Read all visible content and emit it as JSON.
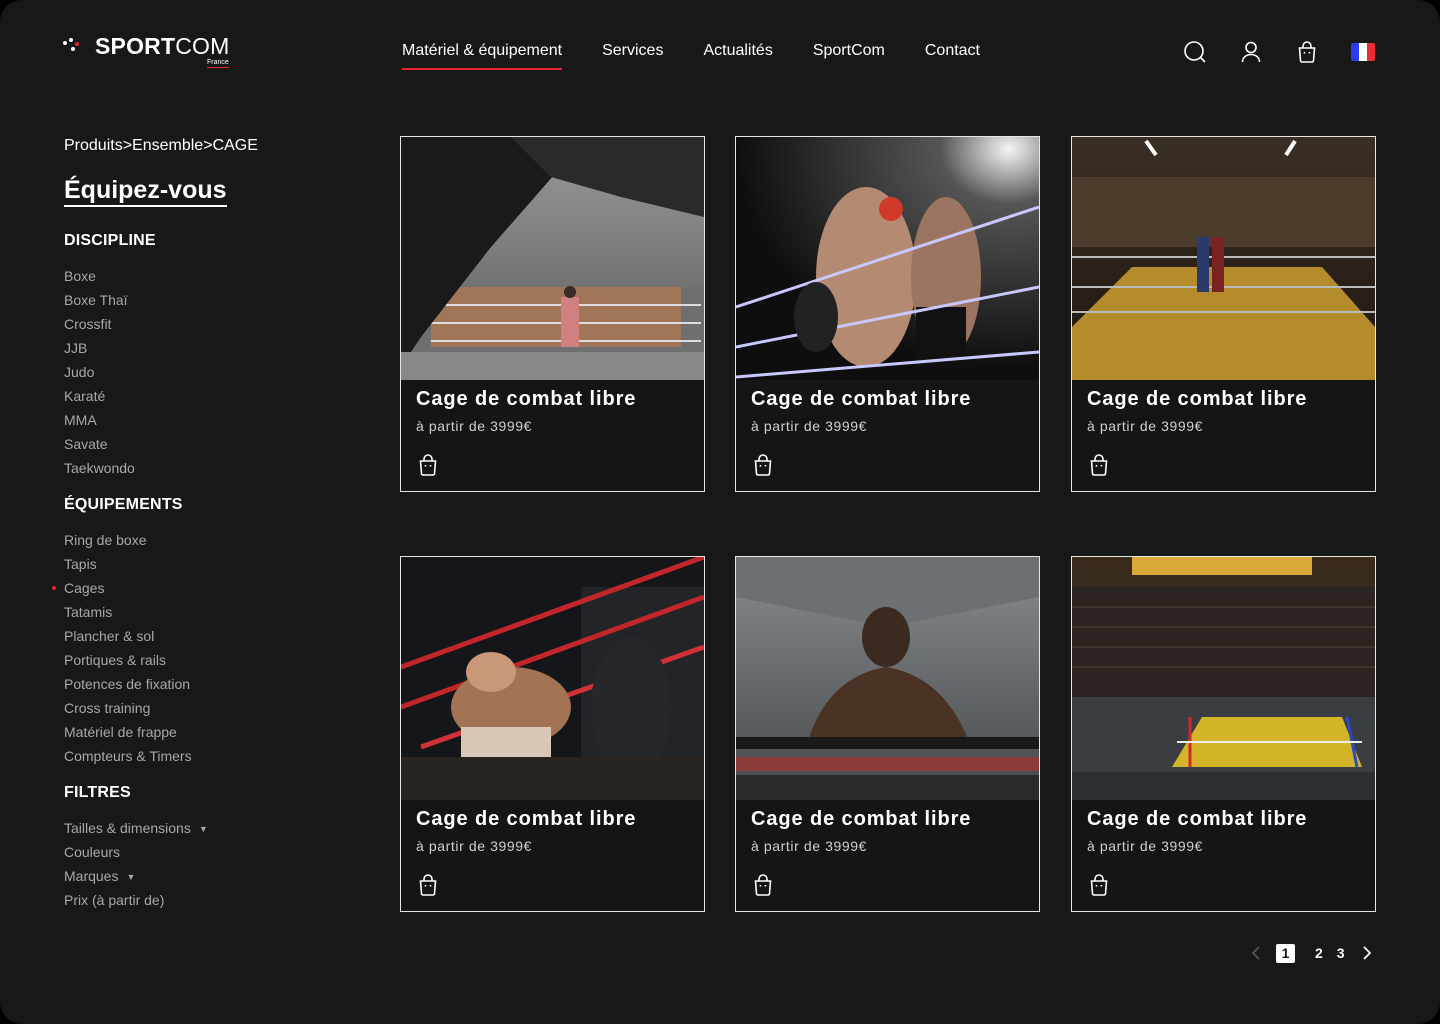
{
  "brand": {
    "name_bold": "SPORT",
    "name_light": "COM",
    "region": "France",
    "accent_color": "#e8232d"
  },
  "nav": {
    "items": [
      {
        "label": "Matériel & équipement",
        "active": true
      },
      {
        "label": "Services",
        "active": false
      },
      {
        "label": "Actualités",
        "active": false
      },
      {
        "label": "SportCom",
        "active": false
      },
      {
        "label": "Contact",
        "active": false
      }
    ]
  },
  "header_icons": [
    "search-icon",
    "user-icon",
    "bag-icon",
    "flag-fr-icon"
  ],
  "breadcrumb": "Produits>Ensemble>CAGE",
  "page_title": "Équipez-vous",
  "sidebar": {
    "discipline": {
      "heading": "DISCIPLINE",
      "items": [
        "Boxe",
        "Boxe Thaï",
        "Crossfit",
        "JJB",
        "Judo",
        "Karaté",
        "MMA",
        "Savate",
        "Taekwondo"
      ]
    },
    "equipements": {
      "heading": "ÉQUIPEMENTS",
      "items": [
        "Ring de boxe",
        "Tapis",
        "Cages",
        "Tatamis",
        "Plancher & sol",
        "Portiques & rails",
        "Potences de fixation",
        "Cross training",
        "Matériel de frappe",
        "Compteurs & Timers"
      ],
      "selected": "Cages"
    },
    "filtres": {
      "heading": "FILTRES",
      "items": [
        "Tailles & dimensions",
        "Couleurs",
        "Marques",
        "Prix (à partir de)"
      ],
      "with_caret": [
        "Tailles & dimensions",
        "Marques"
      ]
    }
  },
  "products": [
    {
      "title": "Cage de combat libre",
      "price": "à partir de 3999€",
      "image": "gym-ring-photo"
    },
    {
      "title": "Cage de combat libre",
      "price": "à partir de 3999€",
      "image": "fighters-in-ring-photo"
    },
    {
      "title": "Cage de combat libre",
      "price": "à partir de 3999€",
      "image": "empty-ring-gym-photo"
    },
    {
      "title": "Cage de combat libre",
      "price": "à partir de 3999€",
      "image": "red-ropes-photo"
    },
    {
      "title": "Cage de combat libre",
      "price": "à partir de 3999€",
      "image": "boxer-portrait-photo"
    },
    {
      "title": "Cage de combat libre",
      "price": "à partir de 3999€",
      "image": "arena-ring-photo"
    }
  ],
  "pagination": {
    "pages": [
      "1",
      "2",
      "3"
    ],
    "current": "1"
  }
}
